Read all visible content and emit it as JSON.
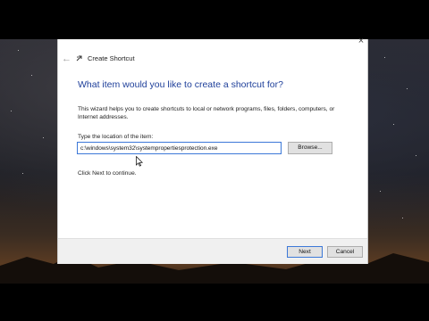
{
  "window": {
    "title": "Create Shortcut",
    "close_glyph": "×",
    "back_glyph": "←"
  },
  "wizard": {
    "heading": "What item would you like to create a shortcut for?",
    "description": "This wizard helps you to create shortcuts to local or network programs, files, folders, computers, or Internet addresses.",
    "location_label": "Type the location of the item:",
    "location_value": "c:\\windows\\system32\\systempropertiesprotection.exe",
    "browse_label": "Browse...",
    "continue_text": "Click Next to continue."
  },
  "footer": {
    "next_label": "Next",
    "cancel_label": "Cancel"
  },
  "colors": {
    "heading": "#1e3f9a",
    "focus_border": "#3c78d8",
    "button_bg": "#e1e1e1",
    "footer_bg": "#f0f0f0"
  },
  "icons": [
    "close-icon",
    "back-arrow-icon",
    "shortcut-wizard-icon",
    "mouse-cursor-icon"
  ]
}
